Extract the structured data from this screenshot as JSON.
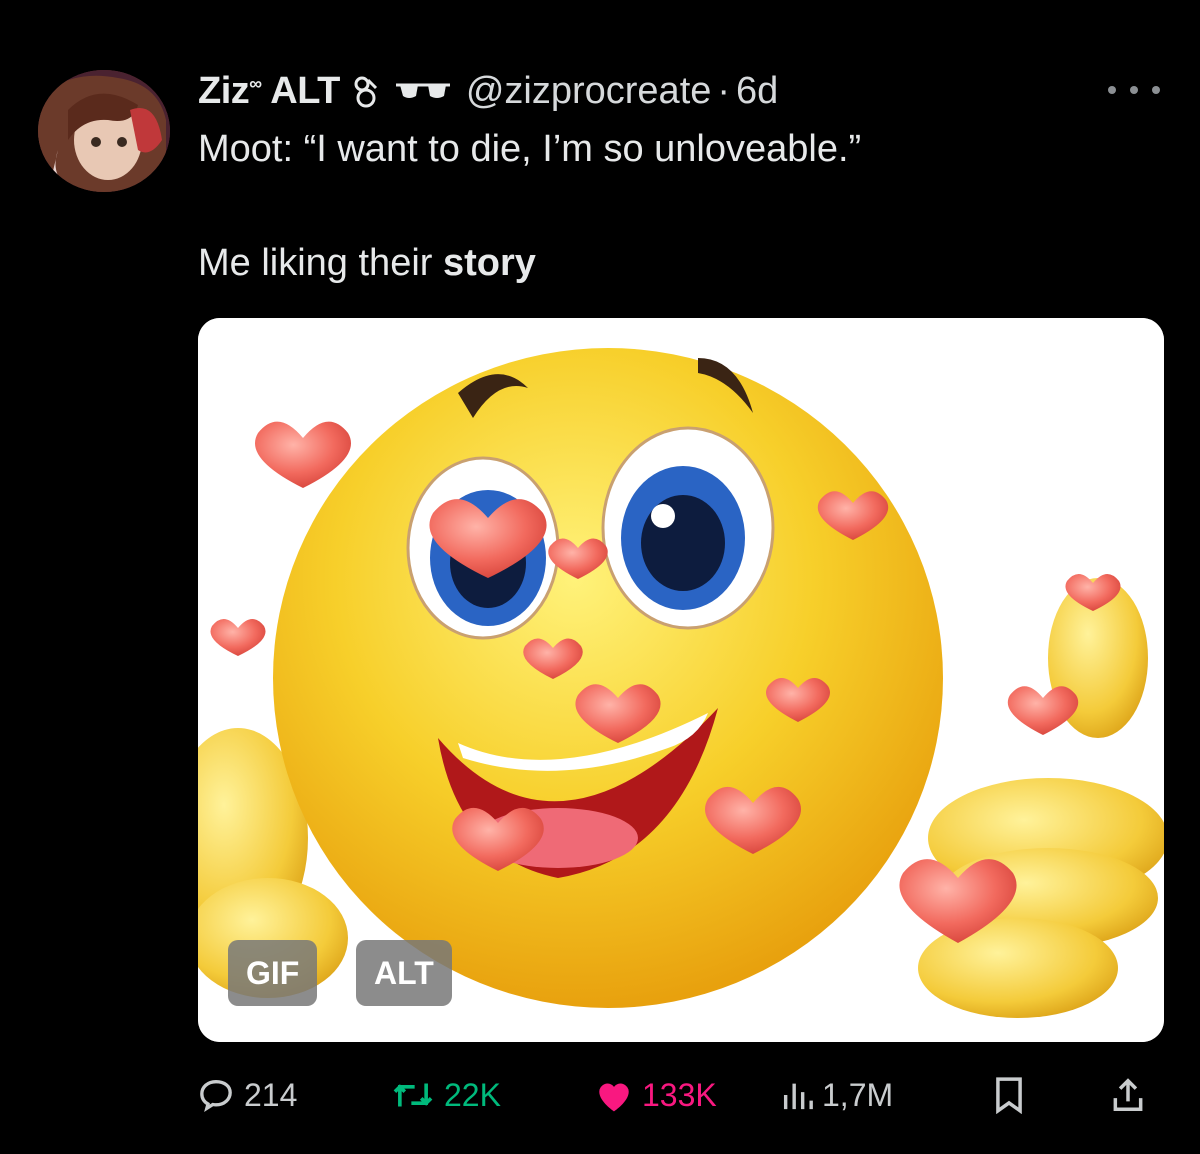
{
  "tweet": {
    "display_name": "Ziz",
    "name_suffix": "ALT",
    "handle": "@zizprocreate",
    "separator": "·",
    "time": "6d",
    "line1": "Moot: “I want to die, I’m so unloveable.”",
    "line2_prefix": "Me liking their ",
    "line2_bold": "story"
  },
  "media": {
    "gif_label": "GIF",
    "alt_label": "ALT"
  },
  "actions": {
    "replies": "214",
    "reposts": "22K",
    "likes": "133K",
    "views": "1,7M"
  },
  "colors": {
    "background": "#000000",
    "text": "#e7e9ea",
    "repost_active": "#00ba7c",
    "like_active": "#f91880"
  },
  "icons": [
    "more-icon",
    "reply-icon",
    "repost-icon",
    "like-icon",
    "views-icon",
    "bookmark-icon",
    "share-icon"
  ]
}
